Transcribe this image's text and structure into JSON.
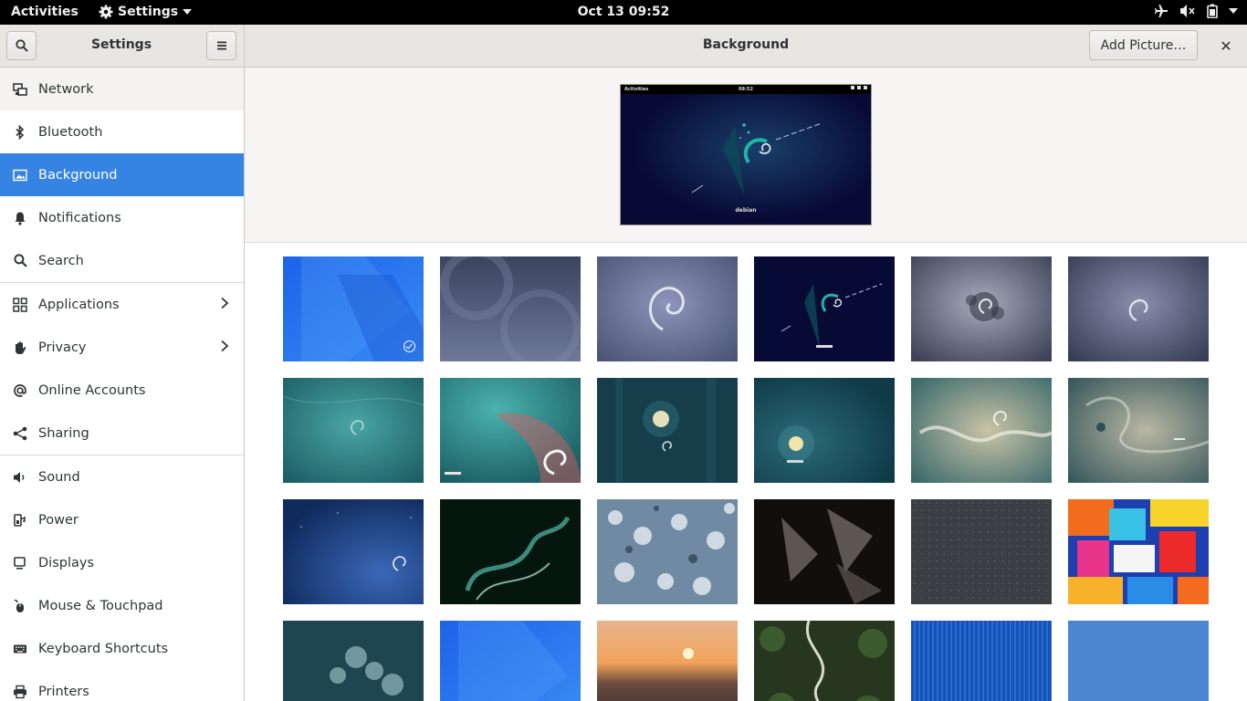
{
  "topbar": {
    "activities": "Activities",
    "app_name": "Settings",
    "clock": "Oct 13  09:52",
    "tray_icons": [
      "airplane-mode-icon",
      "volume-muted-icon",
      "battery-icon",
      "system-menu-arrow-icon"
    ]
  },
  "header": {
    "sidebar_title": "Settings",
    "search_icon": "search-icon",
    "menu_icon": "hamburger-menu-icon",
    "page_title": "Background",
    "add_picture_label": "Add Picture…",
    "close_icon": "close-icon",
    "close_glyph": "✕"
  },
  "sidebar": {
    "selected": "Background",
    "items": [
      {
        "label": "Network",
        "icon": "network-icon"
      },
      {
        "label": "Bluetooth",
        "icon": "bluetooth-icon"
      },
      {
        "label": "Background",
        "icon": "background-icon"
      },
      {
        "label": "Notifications",
        "icon": "bell-icon"
      },
      {
        "label": "Search",
        "icon": "search-icon"
      },
      {
        "label": "Applications",
        "icon": "applications-grid-icon",
        "has_submenu": true
      },
      {
        "label": "Privacy",
        "icon": "hand-icon",
        "has_submenu": true
      },
      {
        "label": "Online Accounts",
        "icon": "at-sign-icon"
      },
      {
        "label": "Sharing",
        "icon": "share-icon"
      },
      {
        "label": "Sound",
        "icon": "speaker-icon"
      },
      {
        "label": "Power",
        "icon": "power-icon"
      },
      {
        "label": "Displays",
        "icon": "display-icon"
      },
      {
        "label": "Mouse & Touchpad",
        "icon": "mouse-icon"
      },
      {
        "label": "Keyboard Shortcuts",
        "icon": "keyboard-icon"
      },
      {
        "label": "Printers",
        "icon": "printer-icon"
      }
    ]
  },
  "preview": {
    "topbar_activities": "Activities",
    "topbar_time": "09:52",
    "logo_text": "debian"
  },
  "wallpapers": {
    "selected_index": 0,
    "items": [
      {
        "name": "blue-geometric"
      },
      {
        "name": "grey-circles"
      },
      {
        "name": "grey-debian-swirl"
      },
      {
        "name": "debian-homeworld-navy"
      },
      {
        "name": "grey-splash-swirl"
      },
      {
        "name": "slate-swirl"
      },
      {
        "name": "teal-swirl"
      },
      {
        "name": "teal-debian-wave"
      },
      {
        "name": "dark-teal-moon"
      },
      {
        "name": "teal-moon-debian"
      },
      {
        "name": "futureprototype-beige"
      },
      {
        "name": "futureprototype-grey"
      },
      {
        "name": "blue-starfield-swirl"
      },
      {
        "name": "green-smoke"
      },
      {
        "name": "snowy-forest"
      },
      {
        "name": "dark-leaves"
      },
      {
        "name": "dark-grey-dots"
      },
      {
        "name": "colorful-painting"
      },
      {
        "name": "frosted-plants"
      },
      {
        "name": "blue-geometric-2"
      },
      {
        "name": "sunset-sea"
      },
      {
        "name": "forest-road"
      },
      {
        "name": "blue-stripes"
      },
      {
        "name": "light-blue-plain"
      }
    ]
  }
}
